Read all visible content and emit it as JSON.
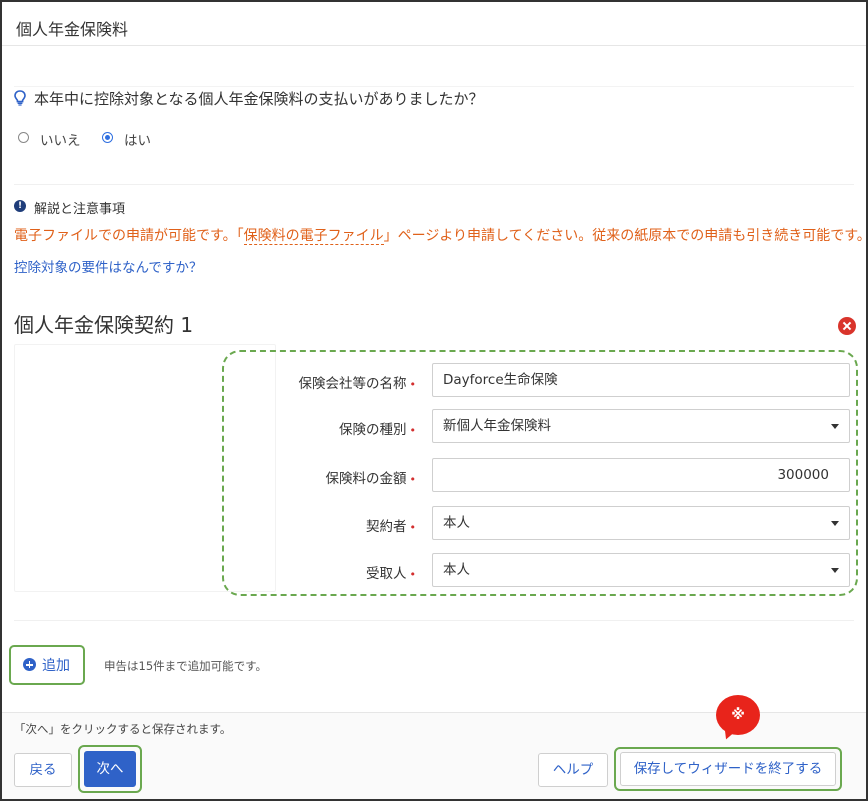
{
  "header": {
    "title": "個人年金保険料"
  },
  "question": {
    "text": "本年中に控除対象となる個人年金保険料の支払いがありましたか？",
    "options": [
      {
        "label": "いいえ",
        "checked": false
      },
      {
        "label": "はい",
        "checked": true
      }
    ]
  },
  "notes": {
    "title": "解説と注意事項",
    "notice_pre": "電子ファイルでの申請が可能です。「",
    "notice_link": "保険料の電子ファイル",
    "notice_post": "」ページより申請してください。従来の紙原本での申請も引き続き可能です。",
    "requirement_link": "控除対象の要件はなんですか？"
  },
  "contract": {
    "title": "個人年金保険契約 1",
    "fields": [
      {
        "label": "保険会社等の名称",
        "required_mark": "•",
        "value": "Dayforce生命保険",
        "type": "text"
      },
      {
        "label": "保険の種別",
        "required_mark": "•",
        "value": "新個人年金保険料",
        "type": "select"
      },
      {
        "label": "保険料の金額",
        "required_mark": "•",
        "value": "300000",
        "type": "number"
      },
      {
        "label": "契約者",
        "required_mark": "•",
        "value": "本人",
        "type": "select"
      },
      {
        "label": "受取人",
        "required_mark": "•",
        "value": "本人",
        "type": "select"
      }
    ]
  },
  "add": {
    "label": "追加",
    "note": "申告は15件まで追加可能です。"
  },
  "footer": {
    "note": "「次へ」をクリックすると保存されます。",
    "back_label": "戻る",
    "next_label": "次へ",
    "help_label": "ヘルプ",
    "finish_label": "保存してウィザードを終了する"
  },
  "annotation": {
    "marker": "※"
  },
  "colors": {
    "primary": "#2f62c8",
    "notice": "#e0611a",
    "required": "#d32f2f",
    "highlight": "#6aa84f",
    "marker": "#e8241b",
    "delete": "#d9342b"
  }
}
